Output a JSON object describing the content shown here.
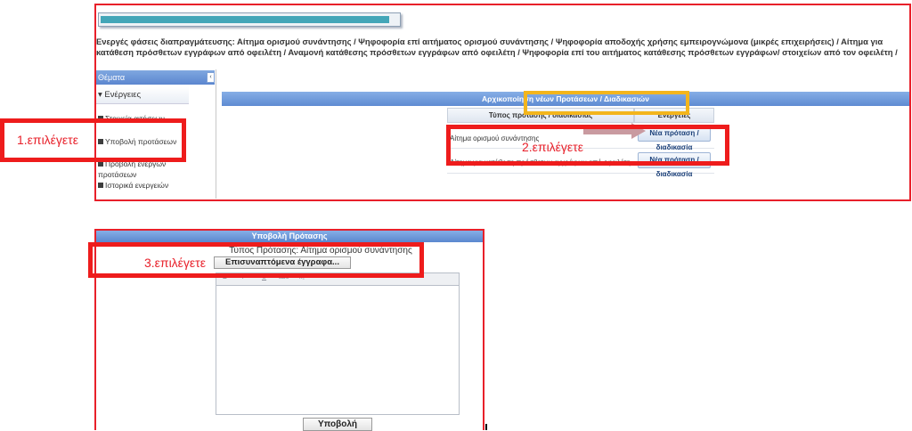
{
  "breadcrumb": {
    "text": "Ενεργές φάσεις διαπραγμάτευσης: Αίτημα ορισμού συνάντησης / Ψηφοφορία επί αιτήματος ορισμού συνάντησης / Ψηφοφορία αποδοχής χρήσης εμπειρογνώμονα (μικρές επιχειρήσεις) / Αίτημα για κατάθεση πρόσθετων εγγράφων από οφειλέτη / Αναμονή κατάθεσης πρόσθετων εγγράφων από οφειλέτη / Ψηφοφορία επί του αιτήματος κατάθεσης πρόσθετων εγγράφων/ στοιχείων από τον οφειλέτη /"
  },
  "progress": {
    "fraction": 0.97
  },
  "sidebar": {
    "header": "Θέματα",
    "collapse_icon": "‹",
    "group_label": "▾ Ενέργειες",
    "items": [
      {
        "label": "Στοιχεία αιτήσεων"
      },
      {
        "label": "Υποβολή προτάσεων"
      },
      {
        "label": "Προβολή ενεργών προτάσεων"
      },
      {
        "label": "Ιστορικά ενεργειών"
      }
    ]
  },
  "main": {
    "header": "Αρχικοποίηση νέων Προτάσεων / Διαδικασιών",
    "table": {
      "columns": [
        "Τύπος πρότασης / διαδικασίας",
        "Ενέργειες"
      ],
      "rows": [
        {
          "type": "Αίτημα ορισμού συνάντησης",
          "action": "Νέα πρόταση / διαδικασία"
        },
        {
          "type": "Αίτημα για κατάθεση πρόσθετων εγγράφων από οφειλέτη",
          "action": "Νέα πρόταση / διαδικασία"
        }
      ]
    }
  },
  "callouts": {
    "step1": "1.επιλέγετε",
    "step2": "2.επιλέγετε",
    "step3": "3.επιλέγετε",
    "red_color": "#ee1c1c",
    "yellow_color": "#f3b51c"
  },
  "dialog": {
    "title": "Υποβολή Πρότασης",
    "type_line": "Τύπος Πρότασης:  Αίτημα ορισμού συνάντησης",
    "attach_label": "Επισυναπτόμενα έγγραφα...",
    "toolbar_icons": [
      "B",
      "I",
      "U",
      "abc",
      "x₂"
    ],
    "editor_value": "",
    "submit_label": "Υποβολή"
  },
  "colors": {
    "accent_blue": "#5e8bd2",
    "progress_teal": "#43a6b8"
  }
}
